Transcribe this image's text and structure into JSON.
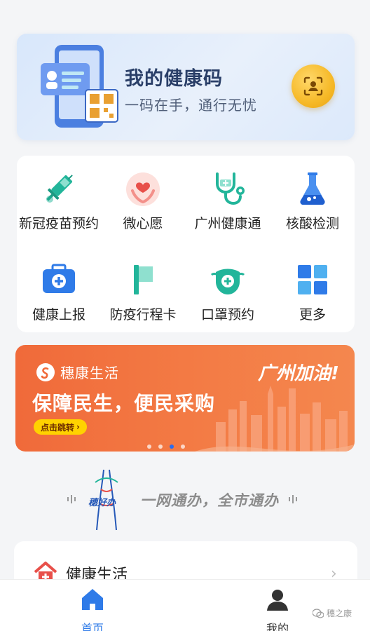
{
  "health_code": {
    "title": "我的健康码",
    "subtitle": "一码在手，通行无忧"
  },
  "services": [
    {
      "label": "新冠疫苗预约",
      "icon": "vaccine-syringe-icon"
    },
    {
      "label": "微心愿",
      "icon": "heart-hands-icon"
    },
    {
      "label": "广州健康通",
      "icon": "stethoscope-icon"
    },
    {
      "label": "核酸检测",
      "icon": "test-flask-icon"
    },
    {
      "label": "健康上报",
      "icon": "medical-kit-icon"
    },
    {
      "label": "防疫行程卡",
      "icon": "flag-icon"
    },
    {
      "label": "口罩预约",
      "icon": "mask-icon"
    },
    {
      "label": "更多",
      "icon": "grid-icon"
    }
  ],
  "banner": {
    "brand": "穗康生活",
    "headline": "保障民生，便民采购",
    "cta": "点击跳转",
    "slogan": "广州加油!",
    "carousel_active_index": 2,
    "carousel_count": 4
  },
  "slogan_row": {
    "brand": "穗好办",
    "text": "一网通办，全市通办"
  },
  "life_section": {
    "title": "健康生活"
  },
  "tabbar": {
    "home_label": "首页",
    "me_label": "我的"
  },
  "watermark": "穗之康",
  "colors": {
    "accent_blue": "#2f7be8",
    "banner_orange": "#f06a3a",
    "scan_gold": "#f6b928",
    "teal": "#22b59a"
  }
}
